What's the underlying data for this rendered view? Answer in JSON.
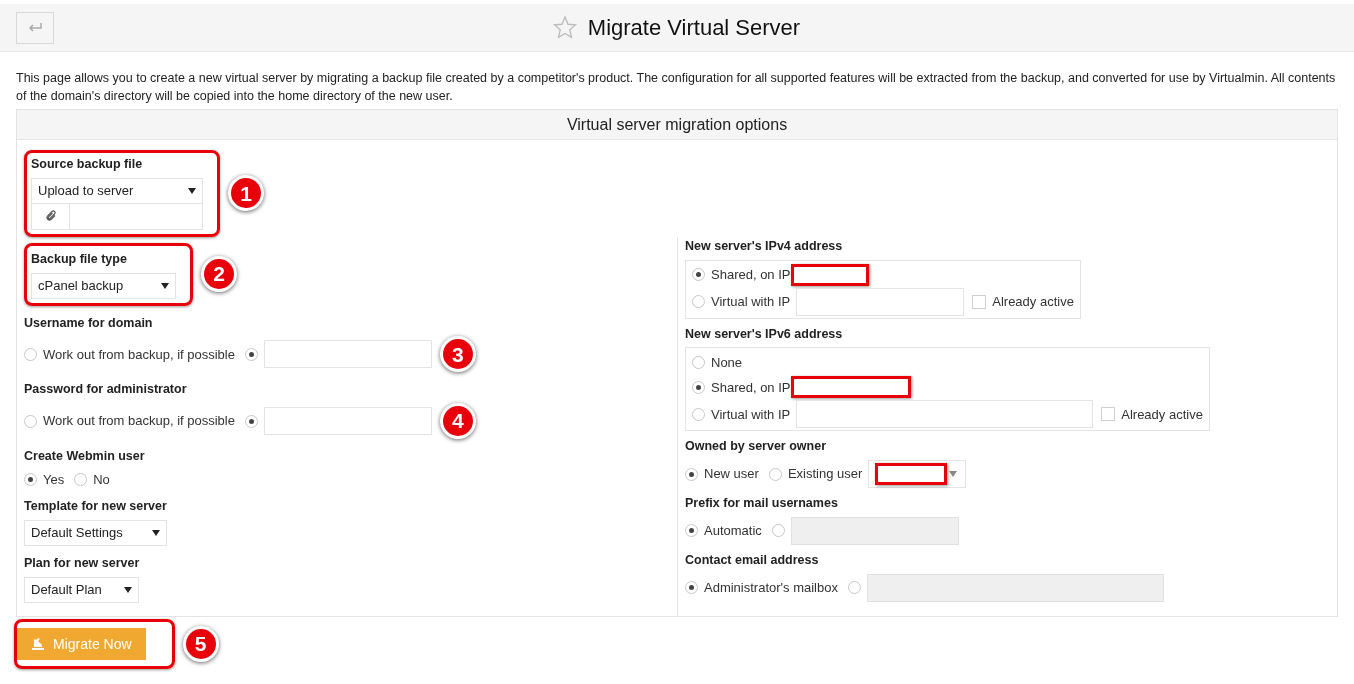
{
  "header": {
    "title": "Migrate Virtual Server"
  },
  "description": "This page allows you to create a new virtual server by migrating a backup file created by a competitor's product. The configuration for all supported features will be extracted from the backup, and converted for use by Virtualmin. All contents of the domain's directory will be copied into the home directory of the new user.",
  "panel": {
    "title": "Virtual server migration options",
    "top_field": {
      "kind": "file_select",
      "label": "Source backup file",
      "value": "Upload to server",
      "callout": "1"
    },
    "left_fields": [
      {
        "kind": "select",
        "label": "Backup file type",
        "value": "cPanel backup",
        "callout": "2"
      },
      {
        "kind": "radios",
        "label": "Username for domain",
        "callout": "3",
        "options": [
          {
            "kind": "text",
            "label": "Work out from backup, if possible",
            "selected": false
          },
          {
            "kind": "input",
            "selected": true,
            "disabled": false
          }
        ]
      },
      {
        "kind": "radios",
        "label": "Password for administrator",
        "callout": "4",
        "options": [
          {
            "kind": "text",
            "label": "Work out from backup, if possible",
            "selected": false
          },
          {
            "kind": "input",
            "selected": true,
            "disabled": false
          }
        ]
      },
      {
        "kind": "radios",
        "label": "Create Webmin user",
        "options": [
          {
            "kind": "text",
            "label": "Yes",
            "selected": true
          },
          {
            "kind": "text",
            "label": "No",
            "selected": false
          }
        ]
      },
      {
        "kind": "select",
        "label": "Template for new server",
        "value": "Default Settings"
      },
      {
        "kind": "select",
        "label": "Plan for new server",
        "value": "Default Plan"
      }
    ],
    "right_fields": [
      {
        "kind": "boxed_radios",
        "label": "New server's IPv4 address",
        "options": [
          {
            "kind": "redacted",
            "label": "Shared, on IP",
            "selected": true
          },
          {
            "kind": "input_check",
            "label": "Virtual with IP",
            "selected": false,
            "check_label": "Already active",
            "checked": false
          }
        ]
      },
      {
        "kind": "boxed_radios",
        "label": "New server's IPv6 address",
        "options": [
          {
            "kind": "text",
            "label": "None",
            "selected": false
          },
          {
            "kind": "redacted",
            "label": "Shared, on IP",
            "selected": true
          },
          {
            "kind": "input_check",
            "label": "Virtual with IP",
            "selected": false,
            "check_label": "Already active",
            "checked": false
          }
        ]
      },
      {
        "kind": "radios",
        "label": "Owned by server owner",
        "options": [
          {
            "kind": "text",
            "label": "New user",
            "selected": true
          },
          {
            "kind": "redacted_select",
            "label": "Existing user",
            "selected": false
          }
        ]
      },
      {
        "kind": "radios",
        "label": "Prefix for mail usernames",
        "options": [
          {
            "kind": "text",
            "label": "Automatic",
            "selected": true
          },
          {
            "kind": "input",
            "selected": false,
            "disabled": true
          }
        ]
      },
      {
        "kind": "radios",
        "label": "Contact email address",
        "options": [
          {
            "kind": "text",
            "label": "Administrator's mailbox",
            "selected": true
          },
          {
            "kind": "input",
            "selected": false,
            "disabled": true
          }
        ]
      }
    ]
  },
  "submit": {
    "label": "Migrate Now",
    "callout": "5"
  }
}
